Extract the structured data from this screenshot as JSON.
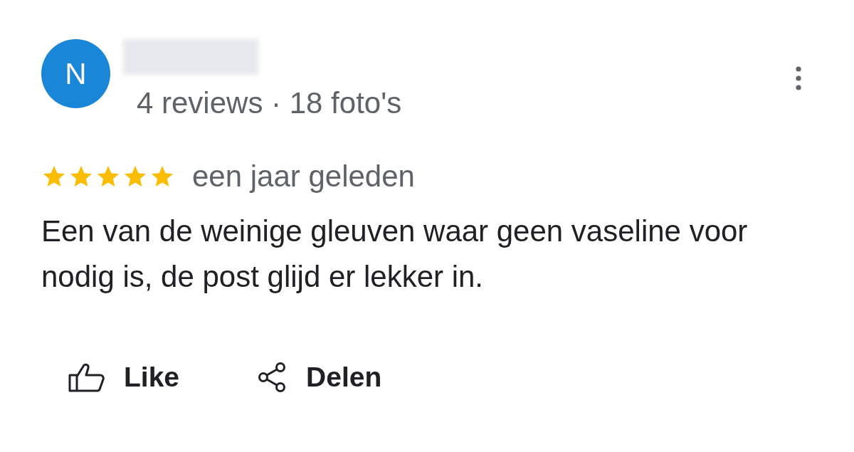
{
  "reviewer": {
    "initial": "N",
    "meta": "4 reviews · 18 foto's"
  },
  "review": {
    "stars": 5,
    "time": "een jaar geleden",
    "text": "Een van de weinige gleuven waar geen vaseline voor nodig is, de post glijd er lekker in."
  },
  "actions": [
    {
      "kind": "like",
      "label": "Like"
    },
    {
      "kind": "share",
      "label": "Delen"
    }
  ]
}
